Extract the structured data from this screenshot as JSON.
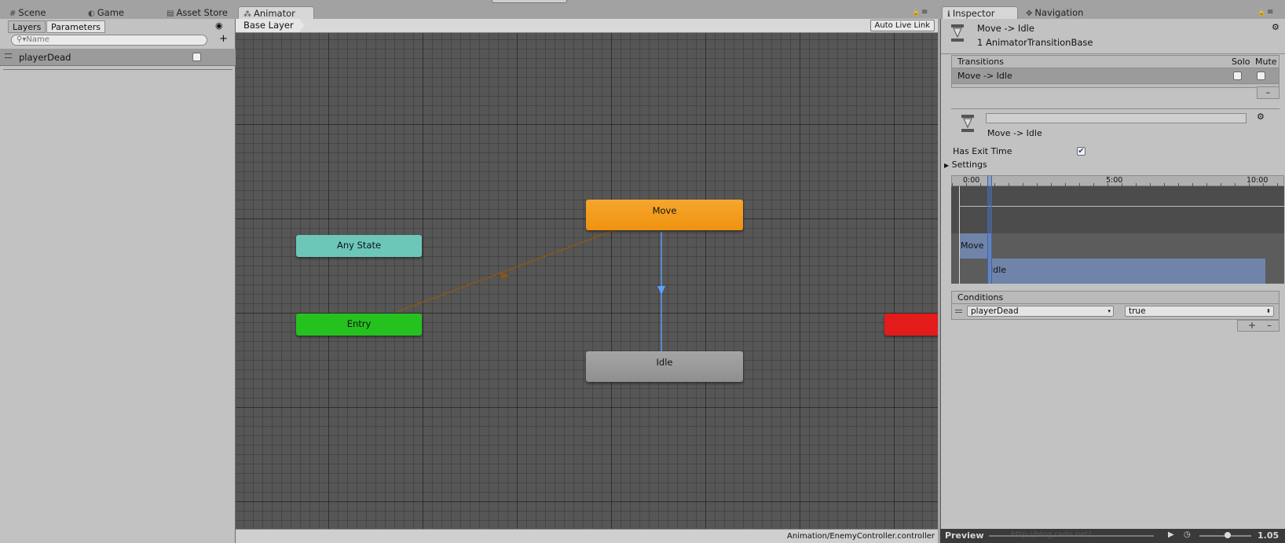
{
  "topbar": {
    "tabs": [
      {
        "icon": "#",
        "label": "Scene"
      },
      {
        "icon": "◐",
        "label": "Game"
      },
      {
        "icon": "▤",
        "label": "Asset Store"
      },
      {
        "icon": "⁂",
        "label": "Animator"
      }
    ],
    "inspector_tabs": [
      {
        "icon": "ℹ",
        "label": "Inspector"
      },
      {
        "icon": "✥",
        "label": "Navigation"
      }
    ],
    "lock_icon": "🔒",
    "menu_icon": "≡"
  },
  "left_panel": {
    "tabs": [
      "Layers",
      "Parameters"
    ],
    "search_placeholder": "Name",
    "add_symbol": "+",
    "eye_icon": "◉",
    "parameters": [
      {
        "name": "playerDead",
        "value": false
      }
    ]
  },
  "graph": {
    "breadcrumb": "Base Layer",
    "auto_live_link": "Auto Live Link",
    "nodes": {
      "move": "Move",
      "any_state": "Any State",
      "entry": "Entry",
      "idle": "Idle"
    },
    "colors": {
      "move": "#f0920f",
      "any_state": "#6cc7b9",
      "entry": "#25c11f",
      "idle": "#8f8f8f",
      "exit": "#e31b1b",
      "transition_default": "#8c5712",
      "transition_selected": "#5aa0ff"
    },
    "controller_path": "Animation/EnemyController.controller"
  },
  "inspector": {
    "title": "Move -> Idle",
    "subtitle": "1 AnimatorTransitionBase",
    "transitions_header": "Transitions",
    "solo_label": "Solo",
    "mute_label": "Mute",
    "transition_row": "Move -> Idle",
    "remove_symbol": "–",
    "transition_name_value": "",
    "transition_label": "Move -> Idle",
    "has_exit_time_label": "Has Exit Time",
    "has_exit_time": true,
    "settings_label": "Settings",
    "timeline_ticks": [
      "0:00",
      "5:00",
      "10:00"
    ],
    "clip_move": "Move",
    "clip_idle": "Idle",
    "conditions_header": "Conditions",
    "condition_param": "playerDead",
    "condition_value": "true",
    "add_symbol": "+",
    "minus_symbol": "–",
    "gear_icon": "⚙"
  },
  "preview": {
    "label": "Preview",
    "speed": "1.05",
    "watermark": "http://blog.csdn.net/..."
  }
}
